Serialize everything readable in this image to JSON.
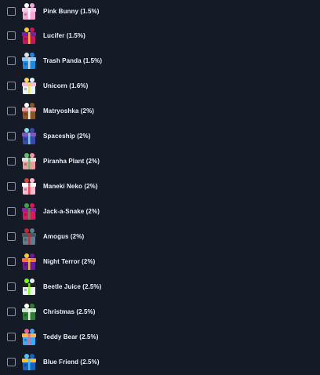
{
  "items": [
    {
      "label": "Pink Bunny (1.5%)",
      "checked": false,
      "icon": "pink-bunny-case-icon",
      "box": "#f7a6d9",
      "lid": "#f4c6ea",
      "accent": "#ffffff"
    },
    {
      "label": "Lucifer (1.5%)",
      "checked": false,
      "icon": "lucifer-case-icon",
      "box": "#c2185b",
      "lid": "#7b1fa2",
      "accent": "#ffcc33"
    },
    {
      "label": "Trash Panda (1.5%)",
      "checked": false,
      "icon": "trash-panda-case-icon",
      "box": "#1e88e5",
      "lid": "#90caf9",
      "accent": "#e0e0e0"
    },
    {
      "label": "Unicorn (1.6%)",
      "checked": false,
      "icon": "unicorn-case-icon",
      "box": "#e1f5fe",
      "lid": "#f8bbd0",
      "accent": "#ffd54f"
    },
    {
      "label": "Matryoshka (2%)",
      "checked": false,
      "icon": "matryoshka-case-icon",
      "box": "#8d5524",
      "lid": "#ef9a9a",
      "accent": "#ffffff"
    },
    {
      "label": "Spaceship (2%)",
      "checked": false,
      "icon": "spaceship-case-icon",
      "box": "#3949ab",
      "lid": "#7e57c2",
      "accent": "#80deea"
    },
    {
      "label": "Piranha Plant (2%)",
      "checked": false,
      "icon": "piranha-plant-case-icon",
      "box": "#ef9a9a",
      "lid": "#e0e0e0",
      "accent": "#66bb6a"
    },
    {
      "label": "Maneki Neko (2%)",
      "checked": false,
      "icon": "maneki-neko-case-icon",
      "box": "#f8bbd0",
      "lid": "#ffffff",
      "accent": "#e53935"
    },
    {
      "label": "Jack-a-Snake (2%)",
      "checked": false,
      "icon": "jack-a-snake-case-icon",
      "box": "#d81b60",
      "lid": "#8e24aa",
      "accent": "#43a047"
    },
    {
      "label": "Amogus (2%)",
      "checked": false,
      "icon": "amogus-case-icon",
      "box": "#607d8b",
      "lid": "#455a64",
      "accent": "#c62828"
    },
    {
      "label": "Night Terror (2%)",
      "checked": false,
      "icon": "night-terror-case-icon",
      "box": "#6a1b9a",
      "lid": "#ff7043",
      "accent": "#ffca28"
    },
    {
      "label": "Beetle Juice (2.5%)",
      "checked": false,
      "icon": "beetle-juice-case-icon",
      "box": "#eceff1",
      "lid": "#212121",
      "accent": "#76ff03"
    },
    {
      "label": "Christmas (2.5%)",
      "checked": false,
      "icon": "christmas-case-icon",
      "box": "#2e7d32",
      "lid": "#c8e6c9",
      "accent": "#ffffff"
    },
    {
      "label": "Teddy Bear (2.5%)",
      "checked": false,
      "icon": "teddy-bear-case-icon",
      "box": "#42a5f5",
      "lid": "#ffb74d",
      "accent": "#f06292"
    },
    {
      "label": "Blue Friend (2.5%)",
      "checked": false,
      "icon": "blue-friend-case-icon",
      "box": "#1565c0",
      "lid": "#fbc02d",
      "accent": "#4fc3f7"
    }
  ]
}
